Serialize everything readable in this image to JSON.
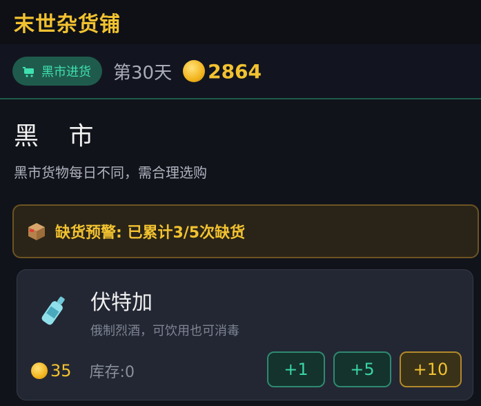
{
  "app": {
    "title": "末世杂货铺"
  },
  "status": {
    "mode_label": "黑市进货",
    "day": "第30天",
    "coins": "2864"
  },
  "section": {
    "title": "黑 市",
    "description": "黑市货物每日不同，需合理选购"
  },
  "warning": {
    "text": "缺货预警: 已累计3/5次缺货"
  },
  "item": {
    "name": "伏特加",
    "description": "俄制烈酒，可饮用也可消毒",
    "price": "35",
    "stock": "库存:0",
    "buttons": {
      "plus1": "+1",
      "plus5": "+5",
      "plus10": "+10"
    }
  },
  "colors": {
    "accent_gold": "#f2c230",
    "accent_green": "#39d5a7",
    "warning_border": "#6e5422"
  },
  "icons": {
    "cart": "cart-icon",
    "coin": "coin-icon",
    "box": "box-icon",
    "bottle": "bottle-icon"
  }
}
